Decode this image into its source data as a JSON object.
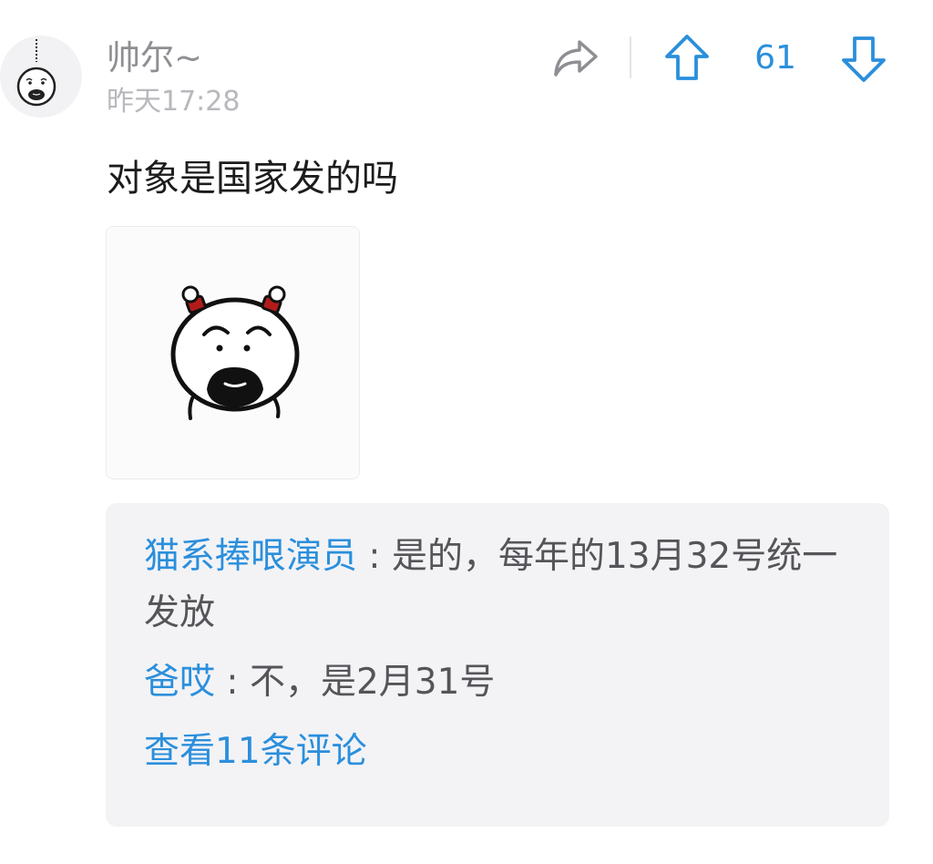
{
  "post": {
    "author": "帅尔~",
    "timestamp": "昨天17:28",
    "text": "对象是国家发的吗",
    "vote_count": "61"
  },
  "icons": {
    "share": "share-icon",
    "upvote": "arrow-up-icon",
    "downvote": "arrow-down-icon",
    "avatar": "avatar-image",
    "post_image": "cartoon-face-sticker"
  },
  "colors": {
    "accent": "#2b8fdc",
    "username": "#8e8e93",
    "timestamp": "#b8b8bd",
    "comment_bg": "#f3f3f6"
  },
  "comments": [
    {
      "author": "猫系捧哏演员",
      "separator": " : ",
      "text": "是的，每年的13月32号统一发放"
    },
    {
      "author": "爸哎",
      "separator": " : ",
      "text": "不，是2月31号"
    }
  ],
  "view_more": "查看11条评论"
}
